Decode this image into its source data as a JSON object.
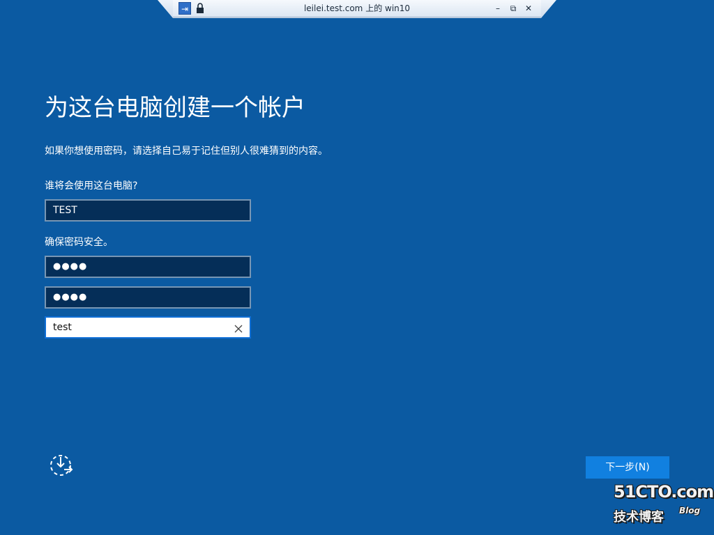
{
  "rdp_bar": {
    "title": "leilei.test.com 上的 win10",
    "pin_icon": "pin-icon",
    "lock_icon": "lock-icon",
    "minimize_glyph": "–",
    "restore_glyph": "⧉",
    "close_glyph": "✕"
  },
  "main": {
    "title": "为这台电脑创建一个帐户",
    "subtitle": "如果你想使用密码，请选择自己易于记住但别人很难猜到的内容。",
    "username_label": "谁将会使用这台电脑?",
    "username_value": "TEST",
    "password_label": "确保密码安全。",
    "password_value": "●●●●",
    "confirm_password_value": "●●●●",
    "hint_value": "test"
  },
  "footer": {
    "ease_of_access_icon": "ease-of-access-icon",
    "next_label": "下一步(N)"
  },
  "watermark": {
    "line1": "51CTO.com",
    "line2": "技术博客",
    "blog": "Blog"
  },
  "colors": {
    "background": "#0b5aa2",
    "field_bg": "#052e58",
    "accent": "#1180e0"
  }
}
